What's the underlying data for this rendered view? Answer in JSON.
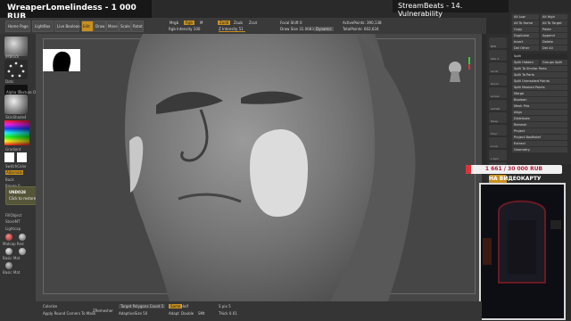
{
  "overlay": {
    "stream_title": "WreaperLomelindess - 1 000 RUB",
    "episode": "StreamBeats - 14. Vulnerability"
  },
  "toolbar": {
    "home_page": "Home Page",
    "lightbox": "LightBox",
    "live_boolean": "Live Boolean",
    "edit": "Edit",
    "draw": "Draw",
    "move": "Move",
    "scale": "Scale",
    "rotate": "Rotat",
    "mrgb": "Mrgb",
    "rgb": "Rgb",
    "m": "M",
    "zadd": "Zadd",
    "zsub": "Zsub",
    "zcut": "Zcut",
    "rgb_intensity": "Rgb Intensity 100",
    "z_intensity": "Z Intensity 51",
    "focal_shift": "Focal Shift 0",
    "draw_size": "Draw Size 31.06835",
    "dynamic": "Dynamic",
    "active_points": "ActivePoints: 390,138",
    "total_points": "TotalPoints: 602,634"
  },
  "left_shelf": {
    "brush_label": "IMBlock",
    "stroke_label": "Dots",
    "alpha_label": "Alpha 0",
    "texture_label": "Texture Off",
    "material_label": "SkinShade4",
    "gradient_label": "Gradient",
    "switch_color": "SwitchColor",
    "alternate": "Alternate",
    "back": "Back",
    "range": "Range 0",
    "fill_object": "FillObject",
    "store_mt": "StoreMT",
    "lightcap": "Lightcap",
    "mats": [
      "Matcap Red",
      "MatCap Gray",
      "Basic Mat",
      "SkinShade4",
      "Basic Mat"
    ]
  },
  "tooltip": {
    "title": "UNDO28",
    "body": "Click to restore previous position."
  },
  "subtool_panel": {
    "top": [
      "All Low",
      "All High",
      "All To Home",
      "All To Target",
      "Copy",
      "Paste",
      "Duplicate",
      "Append",
      "Insert",
      "Delete",
      "Del Other",
      "Del All"
    ],
    "split_header": "Split",
    "split_items": [
      "Split Hidden",
      "Groups Split",
      "Split To Similar Parts",
      "Split To Parts",
      "Split Unmasked Points",
      "Split Masked Points"
    ],
    "items": [
      "Merge",
      "Boolean",
      "Mesh Prio",
      "Align",
      "Distribute",
      "Remesh",
      "Project",
      "Project BasRelief",
      "Extract"
    ],
    "geometry": "Geometry"
  },
  "right_toolbar": [
    "BPR",
    "SPix 3",
    "Scroll",
    "Zoom",
    "Actual",
    "AAHalf",
    "Persp",
    "Floor",
    "Local",
    "L.Sym",
    "Frame",
    "Move",
    "Zoom3D",
    "Rotate",
    "PolyF",
    "Transp",
    "Ghost",
    "Solo",
    "Xpose"
  ],
  "donation": {
    "progress": "1 661 / 30 000 RUB",
    "fraction": 0.055,
    "subtitle": "НА ВИДЕОКАРТУ"
  },
  "bottom_bar": {
    "zremesher": "ZRemesher",
    "target_polygons": "Target Polygons Count 5",
    "adaptive_size": "AdaptiveSize 50",
    "same": "Same",
    "half": "Half",
    "double": "Double",
    "adapt": "Adapt",
    "smt": "SMt",
    "spix": "S pix 5",
    "thick": "Thick 0.01",
    "colorize": "Colorize",
    "apply_round": "Apply Round Corners To Mask"
  },
  "colors": {
    "accent_orange": "#c8901e",
    "donation_red": "#e0303a",
    "gizmo_green": "#3cc840",
    "gizmo_red": "#e03030"
  }
}
